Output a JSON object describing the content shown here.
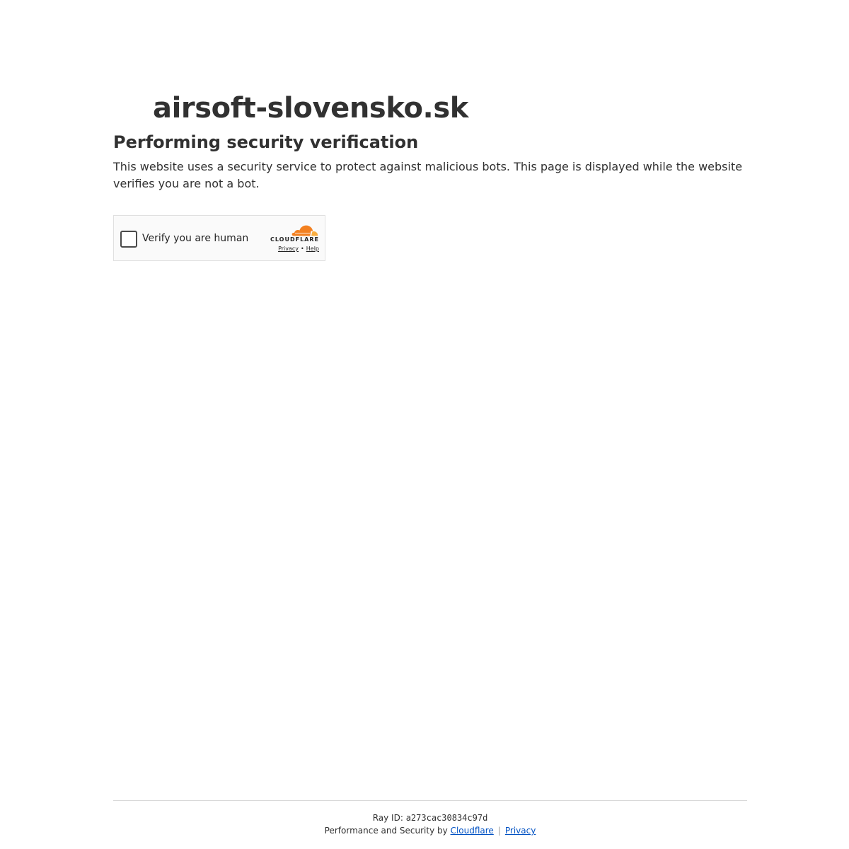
{
  "site": {
    "name": "airsoft-slovensko.sk"
  },
  "main": {
    "heading": "Performing security verification",
    "description": "This website uses a security service to protect against malicious bots. This page is displayed while the website verifies you are not a bot."
  },
  "widget": {
    "checkbox_label": "Verify you are human",
    "checked": false,
    "brand": "CLOUDFLARE",
    "privacy_link": "Privacy",
    "separator": "•",
    "help_link": "Help",
    "logo_icon": "cloudflare-cloud-icon"
  },
  "footer": {
    "ray_label": "Ray ID:",
    "ray_id": "a273cac30834c97d",
    "performance_text": "Performance and Security by",
    "cloudflare_link": "Cloudflare",
    "separator": "|",
    "privacy_link": "Privacy"
  },
  "colors": {
    "text": "#313131",
    "link": "#0051c3",
    "cloudflare_orange": "#f38020",
    "cloudflare_light_orange": "#faae40",
    "widget_background": "#fafafa",
    "widget_border": "#e0e0e0"
  }
}
